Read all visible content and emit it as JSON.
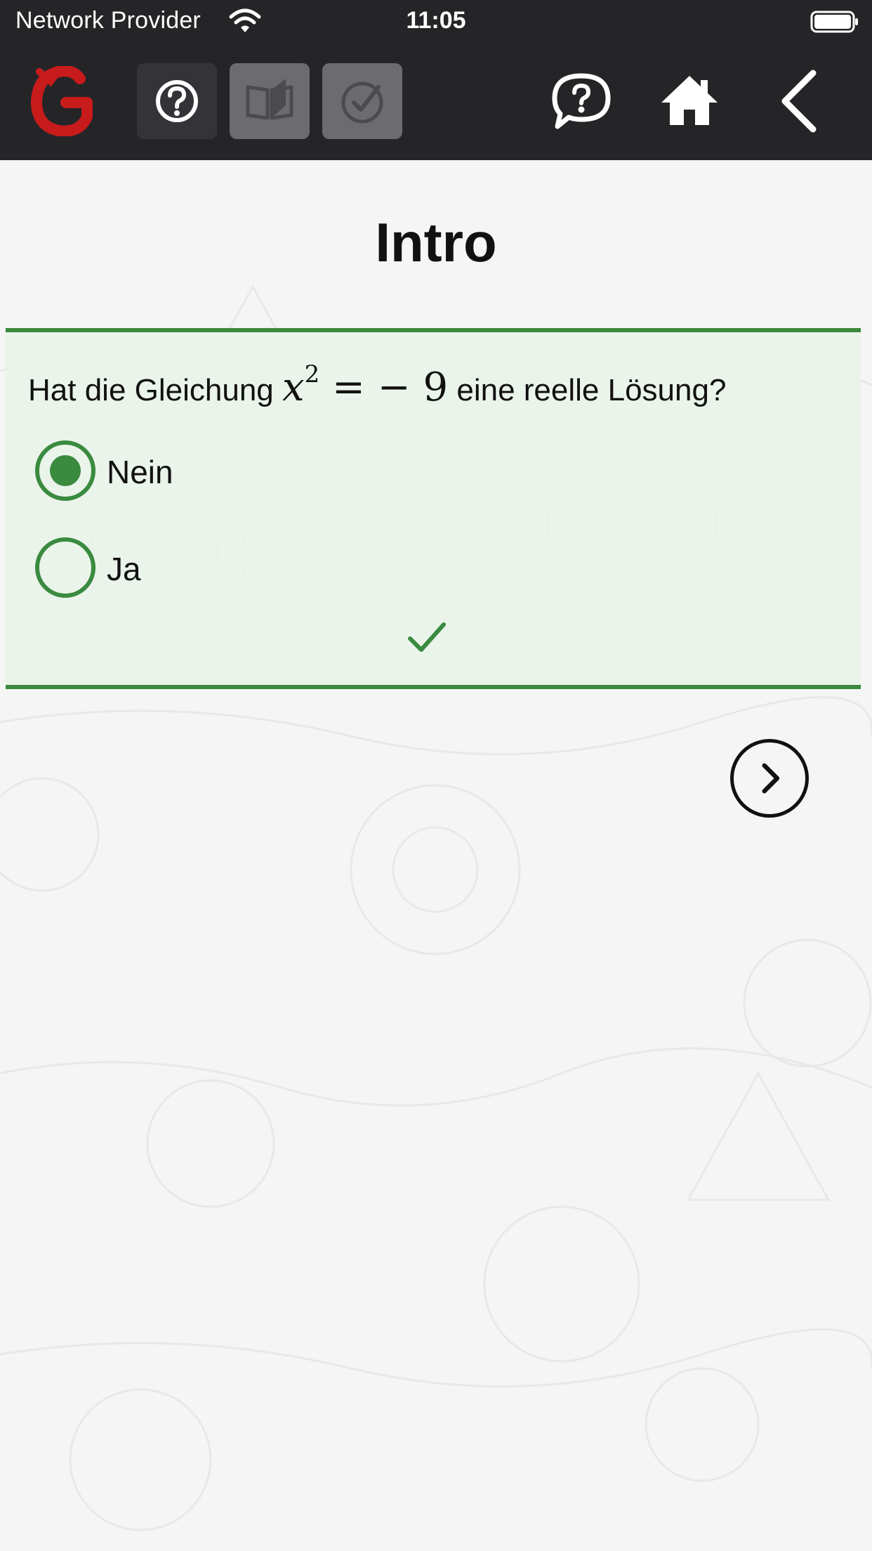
{
  "status_bar": {
    "carrier": "Network Provider",
    "time": "11:05",
    "wifi_icon": "wifi-icon",
    "battery_icon": "battery-icon"
  },
  "header": {
    "logo_icon": "app-logo",
    "tools": [
      {
        "icon": "help-circle-icon",
        "state": "active"
      },
      {
        "icon": "book-icon",
        "state": "disabled"
      },
      {
        "icon": "check-circle-icon",
        "state": "disabled"
      }
    ],
    "nav": [
      {
        "icon": "chat-question-icon"
      },
      {
        "icon": "home-icon"
      },
      {
        "icon": "back-chevron-icon"
      }
    ],
    "background": "#252528",
    "logo_color": "#c81b1b"
  },
  "page": {
    "title": "Intro"
  },
  "question": {
    "text_before": "Hat die Gleichung",
    "math_var": "x",
    "math_exp": "2",
    "math_rest": "= − 9",
    "text_after": "eine reelle Lösung?",
    "options": [
      {
        "label": "Nein",
        "selected": true
      },
      {
        "label": "Ja",
        "selected": false
      }
    ],
    "result_icon": "checkmark-icon",
    "accent_color": "#3a8a3f",
    "panel_color": "#e8f4e8"
  },
  "navigation": {
    "next_icon": "chevron-right-icon"
  }
}
